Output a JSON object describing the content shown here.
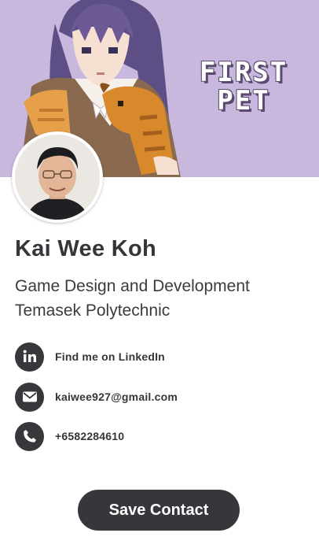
{
  "banner": {
    "title_line1": "FIRST",
    "title_line2": "PET",
    "background_color": "#c8b8de"
  },
  "profile": {
    "name": "Kai Wee Koh",
    "subtitle_line1": "Game Design and Development",
    "subtitle_line2": "Temasek Polytechnic"
  },
  "contacts": [
    {
      "icon": "linkedin-icon",
      "label": "Find me on LinkedIn"
    },
    {
      "icon": "email-icon",
      "label": "kaiwee927@gmail.com"
    },
    {
      "icon": "phone-icon",
      "label": "+6582284610"
    }
  ],
  "actions": {
    "save_label": "Save Contact",
    "button_color": "#36373b"
  }
}
